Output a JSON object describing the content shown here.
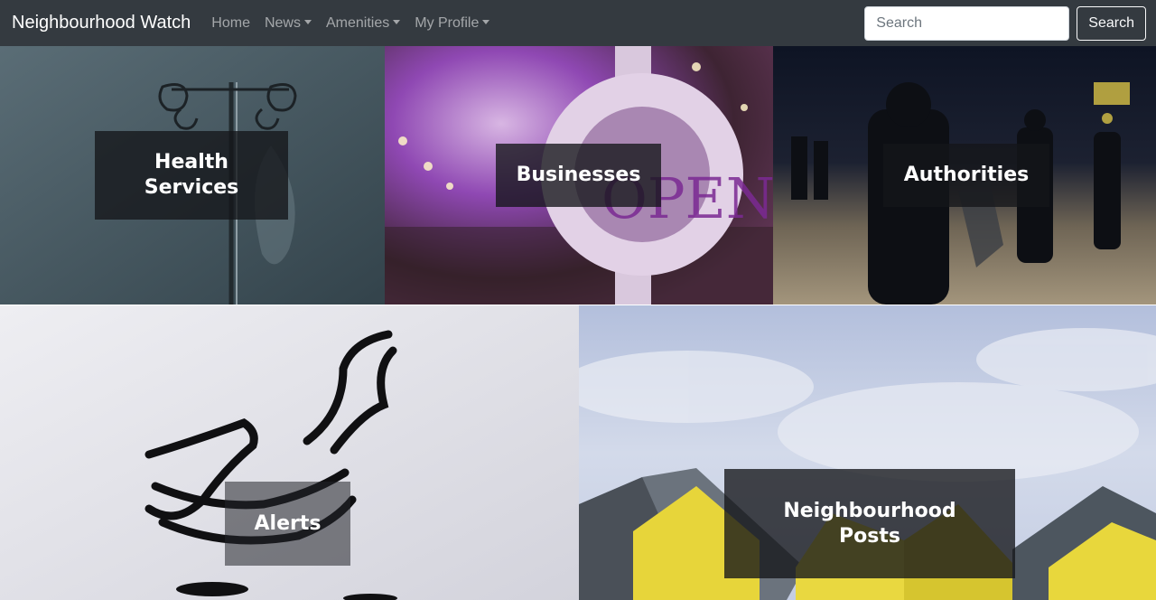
{
  "navbar": {
    "brand": "Neighbourhood Watch",
    "links": [
      {
        "label": "Home",
        "dropdown": false
      },
      {
        "label": "News",
        "dropdown": true
      },
      {
        "label": "Amenities",
        "dropdown": true
      },
      {
        "label": "My Profile",
        "dropdown": true
      }
    ],
    "search": {
      "placeholder": "Search",
      "value": "",
      "button_label": "Search"
    }
  },
  "tiles": [
    {
      "id": "health",
      "label_line1": "Health",
      "label_line2": "Services"
    },
    {
      "id": "businesses",
      "label_line1": "Businesses"
    },
    {
      "id": "authorities",
      "label_line1": "Authorities"
    },
    {
      "id": "alerts",
      "label_line1": "Alerts"
    },
    {
      "id": "posts",
      "label_line1": "Neighbourhood",
      "label_line2": "Posts"
    }
  ],
  "colors": {
    "navbar_bg": "#343a40",
    "label_bg": "#14161a"
  }
}
